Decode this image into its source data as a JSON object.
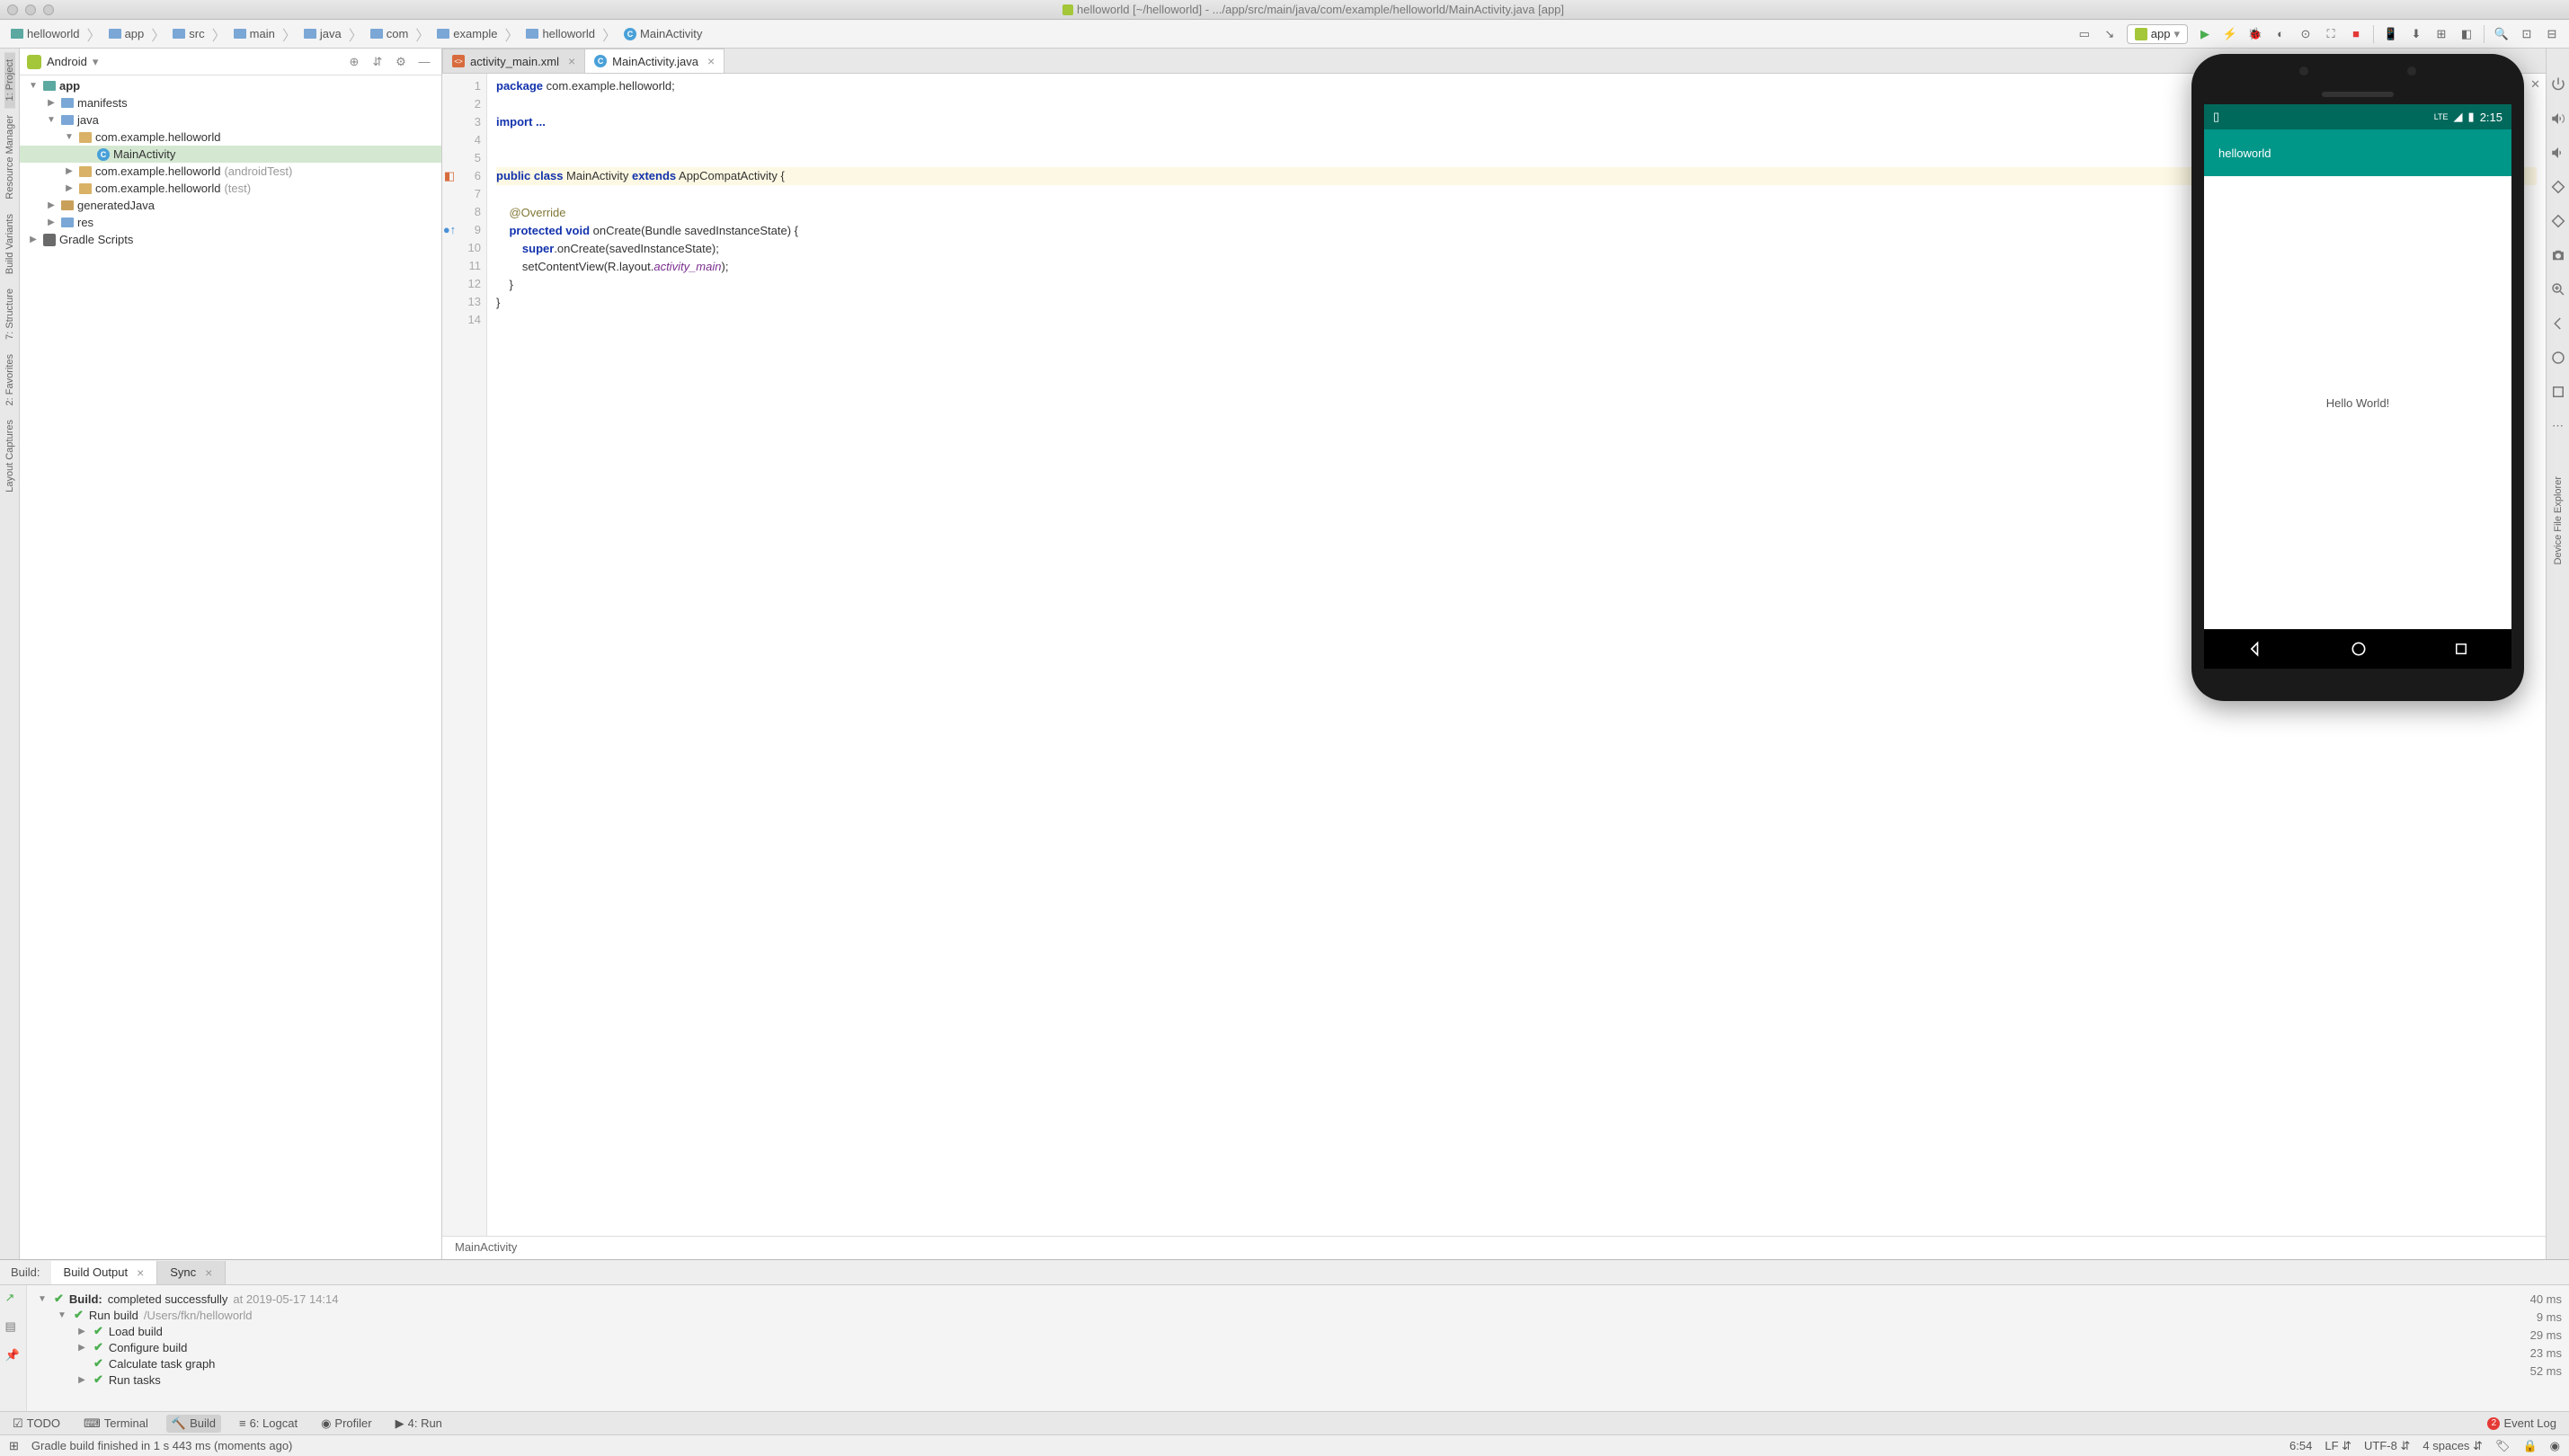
{
  "titlebar": {
    "text": "helloworld [~/helloworld] - .../app/src/main/java/com/example/helloworld/MainActivity.java [app]"
  },
  "breadcrumb": [
    {
      "icon": "folder-teal",
      "label": "helloworld"
    },
    {
      "icon": "folder",
      "label": "app"
    },
    {
      "icon": "folder",
      "label": "src"
    },
    {
      "icon": "folder",
      "label": "main"
    },
    {
      "icon": "folder",
      "label": "java"
    },
    {
      "icon": "folder",
      "label": "com"
    },
    {
      "icon": "folder",
      "label": "example"
    },
    {
      "icon": "folder",
      "label": "helloworld"
    },
    {
      "icon": "class",
      "label": "MainActivity"
    }
  ],
  "run_config": {
    "label": "app"
  },
  "left_strips": [
    {
      "label": "1: Project",
      "active": true
    },
    {
      "label": "Resource Manager",
      "active": false
    },
    {
      "label": "Build Variants",
      "active": false
    },
    {
      "label": "7: Structure",
      "active": false
    },
    {
      "label": "2: Favorites",
      "active": false
    },
    {
      "label": "Layout Captures",
      "active": false
    }
  ],
  "right_strip_label": "Device File Explorer",
  "project": {
    "view": "Android",
    "tree": [
      {
        "depth": 0,
        "tw": "▼",
        "icon": "folder-teal",
        "label": "app",
        "bold": true
      },
      {
        "depth": 1,
        "tw": "▶",
        "icon": "folder",
        "label": "manifests"
      },
      {
        "depth": 1,
        "tw": "▼",
        "icon": "folder",
        "label": "java"
      },
      {
        "depth": 2,
        "tw": "▼",
        "icon": "pkg",
        "label": "com.example.helloworld"
      },
      {
        "depth": 3,
        "tw": "",
        "icon": "class",
        "label": "MainActivity",
        "selected": true
      },
      {
        "depth": 2,
        "tw": "▶",
        "icon": "pkg",
        "label": "com.example.helloworld",
        "suffix": "(androidTest)"
      },
      {
        "depth": 2,
        "tw": "▶",
        "icon": "pkg",
        "label": "com.example.helloworld",
        "suffix": "(test)"
      },
      {
        "depth": 1,
        "tw": "▶",
        "icon": "folder-gen",
        "label": "generatedJava"
      },
      {
        "depth": 1,
        "tw": "▶",
        "icon": "folder",
        "label": "res"
      },
      {
        "depth": 0,
        "tw": "▶",
        "icon": "gradle",
        "label": "Gradle Scripts"
      }
    ]
  },
  "tabs": [
    {
      "icon": "xml",
      "label": "activity_main.xml",
      "active": false
    },
    {
      "icon": "class",
      "label": "MainActivity.java",
      "active": true
    }
  ],
  "editor": {
    "lines": [
      {
        "n": 1,
        "html": "<span class='kw'>package</span> com.example.helloworld;"
      },
      {
        "n": 2,
        "html": ""
      },
      {
        "n": 3,
        "html": "<span class='kw'>import ...</span>"
      },
      {
        "n": 4,
        "html": ""
      },
      {
        "n": 5,
        "html": ""
      },
      {
        "n": 6,
        "html": "<span class='kw'>public class</span> MainActivity <span class='kw'>extends</span> AppCompatActivity {",
        "hl": true,
        "mark": "class"
      },
      {
        "n": 7,
        "html": ""
      },
      {
        "n": 8,
        "html": "    <span class='ann'>@Override</span>"
      },
      {
        "n": 9,
        "html": "    <span class='kw'>protected void</span> onCreate(Bundle savedInstanceState) {",
        "mark": "override"
      },
      {
        "n": 10,
        "html": "        <span class='kw'>super</span>.onCreate(savedInstanceState);"
      },
      {
        "n": 11,
        "html": "        setContentView(R.layout.<span class='ital'>activity_main</span>);"
      },
      {
        "n": 12,
        "html": "    }"
      },
      {
        "n": 13,
        "html": "}"
      },
      {
        "n": 14,
        "html": ""
      }
    ],
    "breadcrumb": "MainActivity"
  },
  "emulator": {
    "status_time": "2:15",
    "status_net": "LTE",
    "app_title": "helloworld",
    "content_text": "Hello World!"
  },
  "build": {
    "header_label": "Build:",
    "tabs": [
      {
        "label": "Build Output",
        "active": true
      },
      {
        "label": "Sync",
        "active": false
      }
    ],
    "tree": [
      {
        "depth": 0,
        "tw": "▼",
        "check": true,
        "bold": "Build:",
        "rest": "completed successfully",
        "dim": "at 2019-05-17 14:14"
      },
      {
        "depth": 1,
        "tw": "▼",
        "check": true,
        "label": "Run build",
        "dim": "/Users/fkn/helloworld"
      },
      {
        "depth": 2,
        "tw": "▶",
        "check": true,
        "label": "Load build"
      },
      {
        "depth": 2,
        "tw": "▶",
        "check": true,
        "label": "Configure build"
      },
      {
        "depth": 2,
        "tw": "",
        "check": true,
        "label": "Calculate task graph"
      },
      {
        "depth": 2,
        "tw": "▶",
        "check": true,
        "label": "Run tasks"
      }
    ],
    "times": [
      "40 ms",
      "9 ms",
      "29 ms",
      "23 ms",
      "52 ms"
    ]
  },
  "bottombar": [
    {
      "icon": "todo",
      "label": "TODO"
    },
    {
      "icon": "terminal",
      "label": "Terminal"
    },
    {
      "icon": "build",
      "label": "Build",
      "active": true
    },
    {
      "icon": "logcat",
      "label": "6: Logcat"
    },
    {
      "icon": "profiler",
      "label": "Profiler"
    },
    {
      "icon": "run",
      "label": "4: Run"
    }
  ],
  "event_log": {
    "count": "2",
    "label": "Event Log"
  },
  "statusbar": {
    "message": "Gradle build finished in 1 s 443 ms (moments ago)",
    "pos": "6:54",
    "sep": "LF",
    "enc": "UTF-8",
    "indent": "4 spaces"
  }
}
